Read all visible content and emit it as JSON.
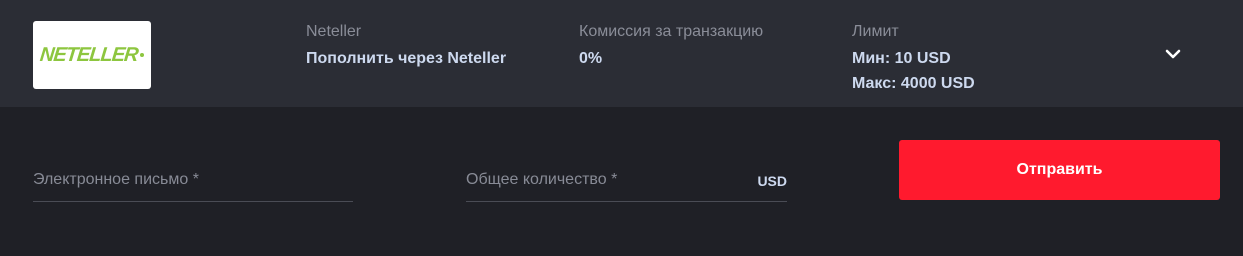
{
  "provider": {
    "logo_text": "NETELLER",
    "logo_color": "#8dc63f"
  },
  "method": {
    "label": "Neteller",
    "value": "Пополнить через Neteller"
  },
  "commission": {
    "label": "Комиссия за транзакцию",
    "value": "0%"
  },
  "limit": {
    "label": "Лимит",
    "min": "Мин: 10 USD",
    "max": "Макс: 4000 USD"
  },
  "expand_icon": "chevron-down-icon",
  "form": {
    "email_placeholder": "Электронное письмо *",
    "amount_placeholder": "Общее количество *",
    "currency": "USD",
    "submit_label": "Отправить",
    "submit_color": "#ff1a2e"
  }
}
